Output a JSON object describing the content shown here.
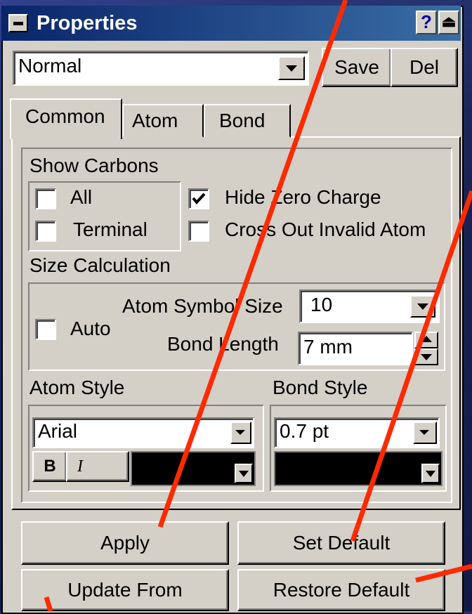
{
  "window": {
    "title": "Properties",
    "help_glyph": "?",
    "rollup_glyph": "⏏"
  },
  "preset": {
    "value": "Normal",
    "save_label": "Save",
    "del_label": "Del"
  },
  "tabs": [
    {
      "label": "Common"
    },
    {
      "label": "Atom"
    },
    {
      "label": "Bond"
    }
  ],
  "common": {
    "show_carbons_label": "Show Carbons",
    "all_label": "All",
    "all_checked": false,
    "terminal_label": "Terminal",
    "terminal_checked": false,
    "hide_zero_charge_label": "Hide Zero Charge",
    "hide_zero_charge_checked": true,
    "cross_out_label": "Cross Out Invalid Atom",
    "cross_out_checked": false,
    "size_calc_label": "Size Calculation",
    "auto_label": "Auto",
    "auto_checked": false,
    "atom_symbol_size_label": "Atom Symbol Size",
    "atom_symbol_size_value": "10",
    "bond_length_label": "Bond Length",
    "bond_length_value": "7 mm",
    "atom_style_label": "Atom Style",
    "atom_font_value": "Arial",
    "bold_label": "B",
    "italic_label": "I",
    "atom_color": "#000000",
    "bond_style_label": "Bond Style",
    "bond_width_value": "0.7 pt",
    "bond_color": "#000000"
  },
  "buttons": {
    "apply": "Apply",
    "set_default": "Set Default",
    "update_from": "Update From",
    "restore_default": "Restore Default"
  },
  "colors": {
    "accent_arrow": "#ff2a00",
    "title_bar_start": "#0a246a",
    "face": "#d4d0c8"
  }
}
